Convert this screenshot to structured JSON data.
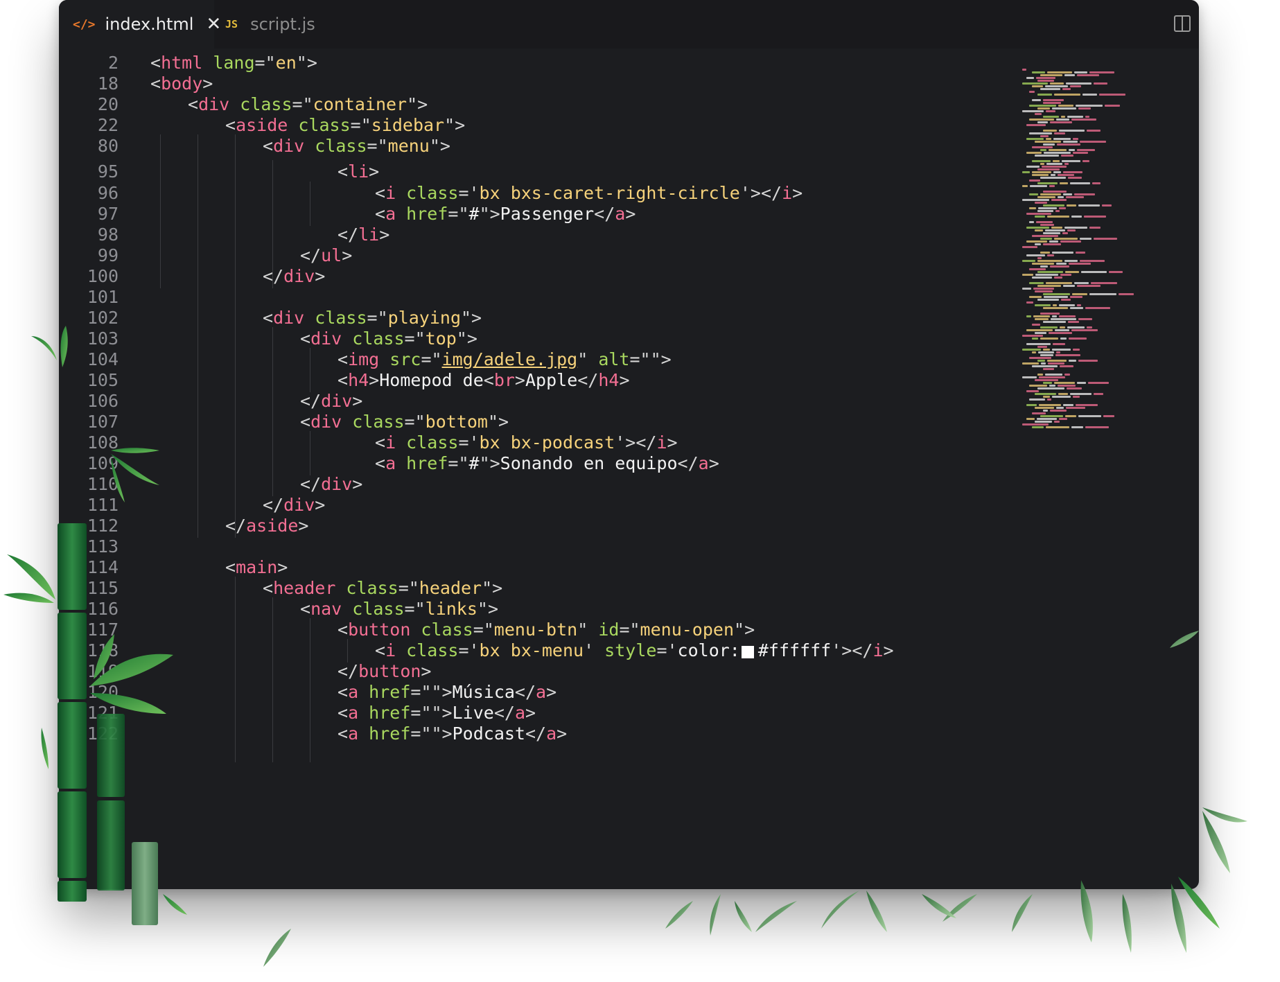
{
  "tabs": [
    {
      "icon": "</>",
      "label": "index.html",
      "close": "✕",
      "active": true
    },
    {
      "icon": "JS",
      "label": "script.js",
      "active": false
    }
  ],
  "colors": {
    "tag": "#f36f93",
    "bracket": "#d6d6d6",
    "attr": "#a9d85f",
    "string": "#f6d27b",
    "text": "#f2f2f2",
    "line_number": "#8e8f94",
    "background": "#1c1d20"
  },
  "code_lines": [
    {
      "n": "2",
      "indent": 0,
      "t": [
        [
          "b",
          "<"
        ],
        [
          "k",
          "html"
        ],
        [
          "a",
          " lang"
        ],
        [
          "b",
          "=\""
        ],
        [
          "s",
          "en"
        ],
        [
          "b",
          "\">"
        ]
      ]
    },
    {
      "n": "18",
      "indent": 0,
      "t": [
        [
          "b",
          "<"
        ],
        [
          "k",
          "body"
        ],
        [
          "b",
          ">"
        ]
      ]
    },
    {
      "n": "20",
      "indent": 1,
      "t": [
        [
          "b",
          "<"
        ],
        [
          "k",
          "div"
        ],
        [
          "a",
          " class"
        ],
        [
          "b",
          "=\""
        ],
        [
          "s",
          "container"
        ],
        [
          "b",
          "\">"
        ]
      ]
    },
    {
      "n": "22",
      "indent": 2,
      "t": [
        [
          "b",
          "<"
        ],
        [
          "k",
          "aside"
        ],
        [
          "a",
          " class"
        ],
        [
          "b",
          "=\""
        ],
        [
          "s",
          "sidebar"
        ],
        [
          "b",
          "\">"
        ]
      ]
    },
    {
      "n": "80",
      "indent": 3,
      "t": [
        [
          "b",
          "<"
        ],
        [
          "k",
          "div"
        ],
        [
          "a",
          " class"
        ],
        [
          "b",
          "=\""
        ],
        [
          "s",
          "menu"
        ],
        [
          "b",
          "\">"
        ]
      ]
    },
    {
      "n": "95",
      "indent": 5,
      "t": [
        [
          "b",
          "<"
        ],
        [
          "k",
          "li"
        ],
        [
          "b",
          ">"
        ]
      ]
    },
    {
      "n": "96",
      "indent": 6,
      "t": [
        [
          "b",
          "<"
        ],
        [
          "k",
          "i"
        ],
        [
          "a",
          " class"
        ],
        [
          "b",
          "='"
        ],
        [
          "s",
          "bx bxs-caret-right-circle"
        ],
        [
          "b",
          "'></"
        ],
        [
          "k",
          "i"
        ],
        [
          "b",
          ">"
        ]
      ]
    },
    {
      "n": "97",
      "indent": 6,
      "t": [
        [
          "b",
          "<"
        ],
        [
          "k",
          "a"
        ],
        [
          "a",
          " href"
        ],
        [
          "b",
          "=\""
        ],
        [
          "x",
          "#"
        ],
        [
          "b",
          "\">"
        ],
        [
          "x",
          "Passenger"
        ],
        [
          "b",
          "</"
        ],
        [
          "k",
          "a"
        ],
        [
          "b",
          ">"
        ]
      ]
    },
    {
      "n": "98",
      "indent": 5,
      "t": [
        [
          "b",
          "</"
        ],
        [
          "k",
          "li"
        ],
        [
          "b",
          ">"
        ]
      ]
    },
    {
      "n": "99",
      "indent": 4,
      "t": [
        [
          "b",
          "</"
        ],
        [
          "k",
          "ul"
        ],
        [
          "b",
          ">"
        ]
      ]
    },
    {
      "n": "100",
      "indent": 3,
      "t": [
        [
          "b",
          "</"
        ],
        [
          "k",
          "div"
        ],
        [
          "b",
          ">"
        ]
      ]
    },
    {
      "n": "101",
      "indent": 0,
      "t": []
    },
    {
      "n": "102",
      "indent": 3,
      "t": [
        [
          "b",
          "<"
        ],
        [
          "k",
          "div"
        ],
        [
          "a",
          " class"
        ],
        [
          "b",
          "=\""
        ],
        [
          "s",
          "playing"
        ],
        [
          "b",
          "\">"
        ]
      ]
    },
    {
      "n": "103",
      "indent": 4,
      "t": [
        [
          "b",
          "<"
        ],
        [
          "k",
          "div"
        ],
        [
          "a",
          " class"
        ],
        [
          "b",
          "=\""
        ],
        [
          "s",
          "top"
        ],
        [
          "b",
          "\">"
        ]
      ]
    },
    {
      "n": "104",
      "indent": 5,
      "t": [
        [
          "b",
          "<"
        ],
        [
          "k",
          "img"
        ],
        [
          "a",
          " src"
        ],
        [
          "b",
          "=\""
        ],
        [
          "u",
          "img/adele.jpg"
        ],
        [
          "b",
          "\""
        ],
        [
          "a",
          " alt"
        ],
        [
          "b",
          "=\"\">"
        ]
      ]
    },
    {
      "n": "105",
      "indent": 5,
      "t": [
        [
          "b",
          "<"
        ],
        [
          "k",
          "h4"
        ],
        [
          "b",
          ">"
        ],
        [
          "x",
          "Homepod de"
        ],
        [
          "b",
          "<"
        ],
        [
          "k",
          "br"
        ],
        [
          "b",
          ">"
        ],
        [
          "x",
          "Apple"
        ],
        [
          "b",
          "</"
        ],
        [
          "k",
          "h4"
        ],
        [
          "b",
          ">"
        ]
      ]
    },
    {
      "n": "106",
      "indent": 4,
      "t": [
        [
          "b",
          "</"
        ],
        [
          "k",
          "div"
        ],
        [
          "b",
          ">"
        ]
      ]
    },
    {
      "n": "107",
      "indent": 4,
      "t": [
        [
          "b",
          "<"
        ],
        [
          "k",
          "div"
        ],
        [
          "a",
          " class"
        ],
        [
          "b",
          "=\""
        ],
        [
          "s",
          "bottom"
        ],
        [
          "b",
          "\">"
        ]
      ]
    },
    {
      "n": "108",
      "indent": 6,
      "t": [
        [
          "b",
          "<"
        ],
        [
          "k",
          "i"
        ],
        [
          "a",
          " class"
        ],
        [
          "b",
          "='"
        ],
        [
          "s",
          "bx bx-podcast"
        ],
        [
          "b",
          "'></"
        ],
        [
          "k",
          "i"
        ],
        [
          "b",
          ">"
        ]
      ]
    },
    {
      "n": "109",
      "indent": 6,
      "t": [
        [
          "b",
          "<"
        ],
        [
          "k",
          "a"
        ],
        [
          "a",
          " href"
        ],
        [
          "b",
          "=\""
        ],
        [
          "x",
          "#"
        ],
        [
          "b",
          "\">"
        ],
        [
          "x",
          "Sonando en equipo"
        ],
        [
          "b",
          "</"
        ],
        [
          "k",
          "a"
        ],
        [
          "b",
          ">"
        ]
      ]
    },
    {
      "n": "110",
      "indent": 4,
      "t": [
        [
          "b",
          "</"
        ],
        [
          "k",
          "div"
        ],
        [
          "b",
          ">"
        ]
      ]
    },
    {
      "n": "111",
      "indent": 3,
      "t": [
        [
          "b",
          "</"
        ],
        [
          "k",
          "div"
        ],
        [
          "b",
          ">"
        ]
      ]
    },
    {
      "n": "112",
      "indent": 2,
      "t": [
        [
          "b",
          "</"
        ],
        [
          "k",
          "aside"
        ],
        [
          "b",
          ">"
        ]
      ]
    },
    {
      "n": "113",
      "indent": 0,
      "t": []
    },
    {
      "n": "114",
      "indent": 2,
      "t": [
        [
          "b",
          "<"
        ],
        [
          "k",
          "main"
        ],
        [
          "b",
          ">"
        ]
      ]
    },
    {
      "n": "115",
      "indent": 3,
      "t": [
        [
          "b",
          "<"
        ],
        [
          "k",
          "header"
        ],
        [
          "a",
          " class"
        ],
        [
          "b",
          "=\""
        ],
        [
          "s",
          "header"
        ],
        [
          "b",
          "\">"
        ]
      ]
    },
    {
      "n": "116",
      "indent": 4,
      "t": [
        [
          "b",
          "<"
        ],
        [
          "k",
          "nav"
        ],
        [
          "a",
          " class"
        ],
        [
          "b",
          "=\""
        ],
        [
          "s",
          "links"
        ],
        [
          "b",
          "\">"
        ]
      ]
    },
    {
      "n": "117",
      "indent": 5,
      "t": [
        [
          "b",
          "<"
        ],
        [
          "k",
          "button"
        ],
        [
          "a",
          " class"
        ],
        [
          "b",
          "=\""
        ],
        [
          "s",
          "menu-btn"
        ],
        [
          "b",
          "\""
        ],
        [
          "a",
          " id"
        ],
        [
          "b",
          "=\""
        ],
        [
          "s",
          "menu-open"
        ],
        [
          "b",
          "\">"
        ]
      ]
    },
    {
      "n": "118",
      "indent": 6,
      "t": [
        [
          "b",
          "<"
        ],
        [
          "k",
          "i"
        ],
        [
          "a",
          " class"
        ],
        [
          "b",
          "='"
        ],
        [
          "s",
          "bx bx-menu"
        ],
        [
          "b",
          "'"
        ],
        [
          "a",
          " style"
        ],
        [
          "b",
          "='"
        ],
        [
          "x",
          "color:"
        ],
        [
          "w",
          "#ffffff"
        ],
        [
          "x",
          "#ffffff"
        ],
        [
          "b",
          "'></"
        ],
        [
          "k",
          "i"
        ],
        [
          "b",
          ">"
        ]
      ]
    },
    {
      "n": "119",
      "indent": 5,
      "t": [
        [
          "b",
          "</"
        ],
        [
          "k",
          "button"
        ],
        [
          "b",
          ">"
        ]
      ]
    },
    {
      "n": "120",
      "indent": 5,
      "t": [
        [
          "b",
          "<"
        ],
        [
          "k",
          "a"
        ],
        [
          "a",
          " href"
        ],
        [
          "b",
          "=\"\">"
        ],
        [
          "x",
          "Música"
        ],
        [
          "b",
          "</"
        ],
        [
          "k",
          "a"
        ],
        [
          "b",
          ">"
        ]
      ]
    },
    {
      "n": "121",
      "indent": 5,
      "t": [
        [
          "b",
          "<"
        ],
        [
          "k",
          "a"
        ],
        [
          "a",
          " href"
        ],
        [
          "b",
          "=\"\">"
        ],
        [
          "x",
          "Live"
        ],
        [
          "b",
          "</"
        ],
        [
          "k",
          "a"
        ],
        [
          "b",
          ">"
        ]
      ]
    },
    {
      "n": "122",
      "indent": 5,
      "t": [
        [
          "b",
          "<"
        ],
        [
          "k",
          "a"
        ],
        [
          "a",
          " href"
        ],
        [
          "b",
          "=\"\">"
        ],
        [
          "x",
          "Podcast"
        ],
        [
          "b",
          "</"
        ],
        [
          "k",
          "a"
        ],
        [
          "b",
          ">"
        ]
      ]
    }
  ]
}
